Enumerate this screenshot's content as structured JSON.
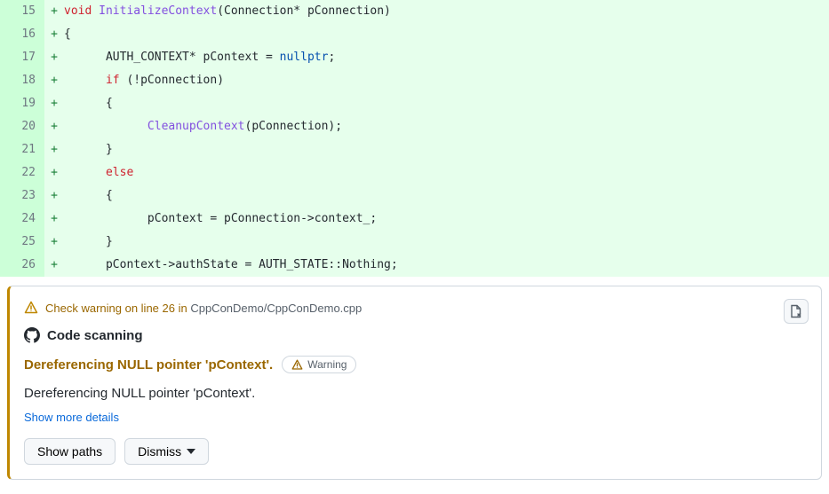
{
  "code": {
    "lines": [
      {
        "num": "15",
        "segments": [
          {
            "t": "void ",
            "cls": "kw-red"
          },
          {
            "t": "InitializeContext",
            "cls": "kw-purple"
          },
          {
            "t": "(Connection* pConnection)"
          }
        ]
      },
      {
        "num": "16",
        "segments": [
          {
            "t": "{"
          }
        ]
      },
      {
        "num": "17",
        "segments": [
          {
            "t": "      AUTH_CONTEXT* pContext = "
          },
          {
            "t": "nullptr",
            "cls": "kw-blue"
          },
          {
            "t": ";"
          }
        ]
      },
      {
        "num": "18",
        "segments": [
          {
            "t": "      "
          },
          {
            "t": "if",
            "cls": "kw-red"
          },
          {
            "t": " (!pConnection)"
          }
        ]
      },
      {
        "num": "19",
        "segments": [
          {
            "t": "      {"
          }
        ]
      },
      {
        "num": "20",
        "segments": [
          {
            "t": "            "
          },
          {
            "t": "CleanupContext",
            "cls": "kw-purple"
          },
          {
            "t": "(pConnection);"
          }
        ]
      },
      {
        "num": "21",
        "segments": [
          {
            "t": "      }"
          }
        ]
      },
      {
        "num": "22",
        "segments": [
          {
            "t": "      "
          },
          {
            "t": "else",
            "cls": "kw-red"
          }
        ]
      },
      {
        "num": "23",
        "segments": [
          {
            "t": "      {"
          }
        ]
      },
      {
        "num": "24",
        "segments": [
          {
            "t": "            pContext = pConnection->context_;"
          }
        ]
      },
      {
        "num": "25",
        "segments": [
          {
            "t": "      }"
          }
        ]
      },
      {
        "num": "26",
        "segments": [
          {
            "t": "      pContext->authState = AUTH_STATE::Nothing;"
          }
        ]
      }
    ],
    "addition_marker": "+"
  },
  "alert": {
    "heading_prefix": "Check warning on line 26 in ",
    "heading_file": "CppConDemo/CppConDemo.cpp",
    "scanning_title": "Code scanning",
    "rule_name": "Dereferencing NULL pointer 'pContext'.",
    "severity_label": "Warning",
    "description": "Dereferencing NULL pointer 'pContext'.",
    "details_link": "Show more details",
    "show_paths": "Show paths",
    "dismiss": "Dismiss"
  }
}
